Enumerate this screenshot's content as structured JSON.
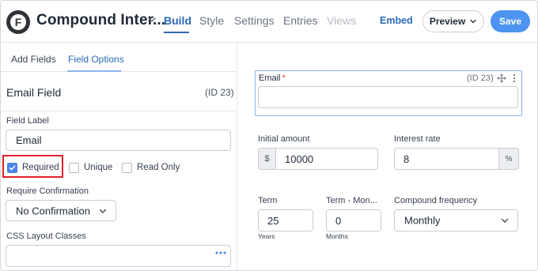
{
  "header": {
    "form_title": "Compound Inter...",
    "tabs": [
      {
        "label": "Build",
        "state": "active"
      },
      {
        "label": "Style",
        "state": "normal"
      },
      {
        "label": "Settings",
        "state": "normal"
      },
      {
        "label": "Entries",
        "state": "normal"
      },
      {
        "label": "Views",
        "state": "disabled"
      }
    ],
    "embed_label": "Embed",
    "preview_label": "Preview",
    "save_label": "Save"
  },
  "sidebar": {
    "tabs": [
      {
        "label": "Add Fields",
        "active": false
      },
      {
        "label": "Field Options",
        "active": true
      }
    ],
    "section_title": "Email Field",
    "section_id": "(ID 23)",
    "field_label_title": "Field Label",
    "field_label_value": "Email",
    "options": [
      {
        "label": "Required",
        "checked": true
      },
      {
        "label": "Unique",
        "checked": false
      },
      {
        "label": "Read Only",
        "checked": false
      }
    ],
    "require_confirmation_title": "Require Confirmation",
    "require_confirmation_value": "No Confirmation",
    "css_classes_title": "CSS Layout Classes",
    "css_classes_value": ""
  },
  "canvas": {
    "email_field": {
      "label": "Email",
      "required_marker": "*",
      "id_text": "(ID 23)",
      "value": ""
    },
    "initial_amount": {
      "label": "Initial amount",
      "prefix": "$",
      "value": "10000"
    },
    "interest_rate": {
      "label": "Interest rate",
      "value": "8",
      "suffix": "%"
    },
    "term": {
      "label": "Term",
      "value": "25",
      "sublabel": "Years"
    },
    "term_months": {
      "label": "Term - Mon...",
      "value": "0",
      "sublabel": "Months"
    },
    "compound_frequency": {
      "label": "Compound frequency",
      "value": "Monthly"
    }
  },
  "colors": {
    "accent": "#2c6ab7",
    "save_button": "#4d94f0",
    "highlight": "#e0202a",
    "required_star": "#d63638",
    "checkbox_checked": "#4a86e8"
  },
  "icons": [
    "logo-icon",
    "chevron-down-icon",
    "move-icon",
    "more-vertical-icon",
    "checkmark-icon",
    "ellipsis-icon"
  ]
}
